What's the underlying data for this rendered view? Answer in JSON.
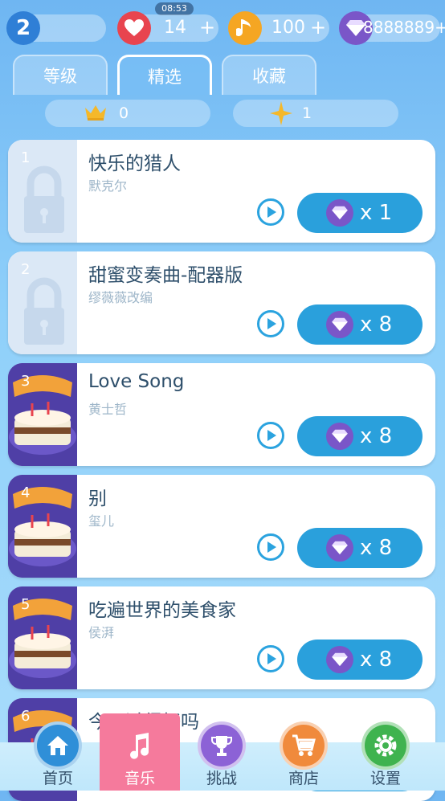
{
  "status": {
    "time": "08:53"
  },
  "top_bar": {
    "level": "2",
    "lives": "14",
    "notes": "100",
    "gems": "8888889+",
    "plus": "+"
  },
  "tabs": [
    {
      "label": "等级"
    },
    {
      "label": "精选",
      "active": true
    },
    {
      "label": "收藏"
    }
  ],
  "stats": {
    "crowns": "0",
    "stars": "1"
  },
  "songs": [
    {
      "num": "1",
      "title": "快乐的猎人",
      "artist": "默克尔",
      "price": "x 1",
      "locked": true
    },
    {
      "num": "2",
      "title": "甜蜜变奏曲-配器版",
      "artist": "缪薇薇改编",
      "price": "x 8",
      "locked": true
    },
    {
      "num": "3",
      "title": "Love Song",
      "artist": "黄士哲",
      "price": "x 8",
      "locked": false
    },
    {
      "num": "4",
      "title": "别",
      "artist": "玺儿",
      "price": "x 8",
      "locked": false
    },
    {
      "num": "5",
      "title": "吃遍世界的美食家",
      "artist": "侯湃",
      "price": "x 8",
      "locked": false
    },
    {
      "num": "6",
      "title": "今天过得好吗",
      "artist": "",
      "price": "",
      "locked": false
    }
  ],
  "nav": [
    {
      "label": "首页",
      "icon": "home-icon",
      "color": "#2f8fd8"
    },
    {
      "label": "音乐",
      "icon": "music-note-icon",
      "color": "#f57a9c",
      "active": true
    },
    {
      "label": "挑战",
      "icon": "trophy-icon",
      "color": "#8c62d6"
    },
    {
      "label": "商店",
      "icon": "cart-icon",
      "color": "#f08a3c"
    },
    {
      "label": "设置",
      "icon": "gear-icon",
      "color": "#3fb34f"
    }
  ],
  "colors": {
    "accent": "#2aa0dc",
    "gem": "#7a56c8",
    "heart": "#e8444f",
    "note": "#f5a623"
  }
}
